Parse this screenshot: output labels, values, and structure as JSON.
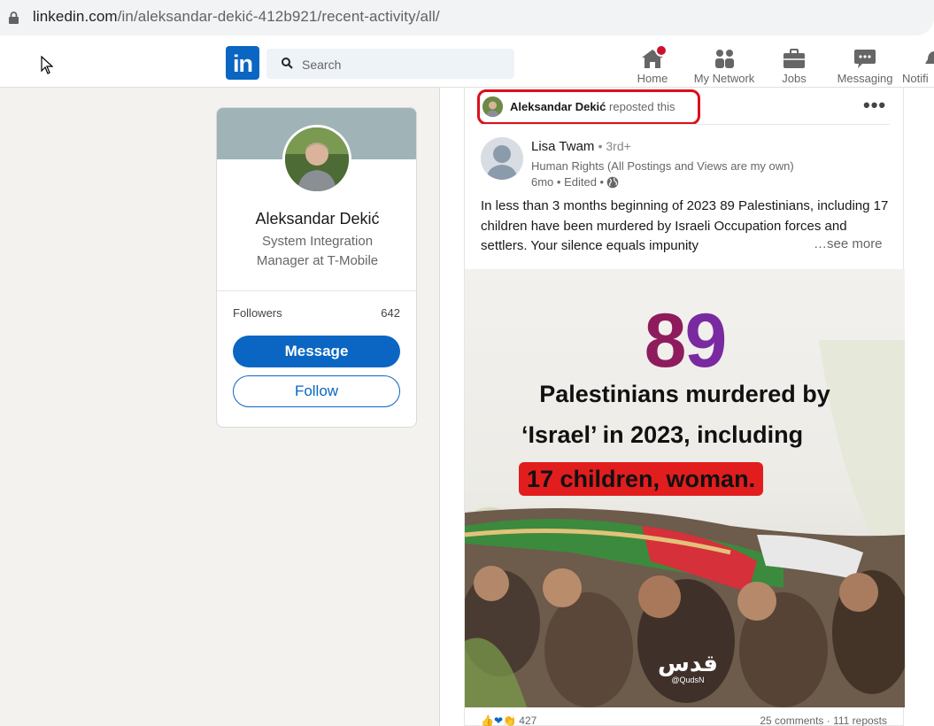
{
  "browser": {
    "url_main": "linkedin.com",
    "url_path": "/in/aleksandar-dekić-412b921/recent-activity/all/"
  },
  "header": {
    "search_placeholder": "Search",
    "nav": [
      {
        "label": "Home",
        "icon": "home-icon"
      },
      {
        "label": "My Network",
        "icon": "network-icon"
      },
      {
        "label": "Jobs",
        "icon": "briefcase-icon"
      },
      {
        "label": "Messaging",
        "icon": "chat-icon"
      },
      {
        "label": "Notifi",
        "icon": "bell-icon"
      }
    ]
  },
  "profile": {
    "name": "Aleksandar Dekić",
    "headline": "System Integration Manager at T-Mobile",
    "followers_label": "Followers",
    "followers_count": "642",
    "message_label": "Message",
    "follow_label": "Follow"
  },
  "post": {
    "reposter_name": "Aleksandar Dekić",
    "repost_action": "reposted this",
    "author_name": "Lisa Twam",
    "author_degree": "• 3rd+",
    "author_headline": "Human Rights (All Postings and Views are my own)",
    "author_meta": "6mo • Edited •",
    "body": "In less than 3 months beginning of 2023 89 Palestinians, including 17 children have been murdered by Israeli Occupation forces and settlers. Your silence equals impunity",
    "see_more": "…see more",
    "image": {
      "number_first": "8",
      "number_second": "9",
      "line1": "Palestinians murdered by",
      "line2": "‘Israel’ in 2023, including",
      "line3": "17 children, woman.",
      "logo": "قدس",
      "logo_handle": "@QudsN"
    },
    "reactions_count": "427",
    "stats": "25 comments · 111 reposts"
  },
  "colors": {
    "brand": "#0a66c2",
    "highlight": "#d9101c",
    "notification_badge": "#cb112d"
  }
}
